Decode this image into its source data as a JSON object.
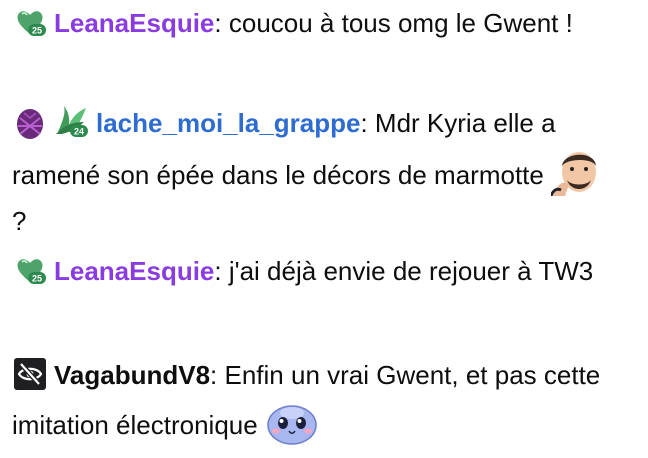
{
  "messages": [
    {
      "badges": [
        "heart-sub-badge-25"
      ],
      "username": "LeanaEsquie",
      "username_color": "#8a3ce0",
      "separator": ": ",
      "text": "coucou à tous omg le Gwent !"
    },
    {
      "badges": [
        "pineapple-badge",
        "sub-badge-24"
      ],
      "username": "lache_moi_la_grappe",
      "username_color": "#2e6cd1",
      "separator": ": ",
      "text": "Mdr Kyria elle a ramené son épée dans le décors de marmotte",
      "trailing_emote": "thinking-man-emote",
      "text_after": " ?"
    },
    {
      "badges": [
        "heart-sub-badge-25"
      ],
      "username": "LeanaEsquie",
      "username_color": "#8a3ce0",
      "separator": ": ",
      "text": "j'ai déjà envie de rejouer à TW3"
    },
    {
      "badges": [
        "eye-slash-badge"
      ],
      "username": "VagabundV8",
      "username_color": "#0e0e10",
      "separator": ": ",
      "text": "Enfin un vrai Gwent, et pas cette imitation électronique",
      "trailing_emote": "blue-blob-emote"
    }
  ],
  "badge_labels": {
    "sub_25": "25",
    "sub_24": "24"
  }
}
